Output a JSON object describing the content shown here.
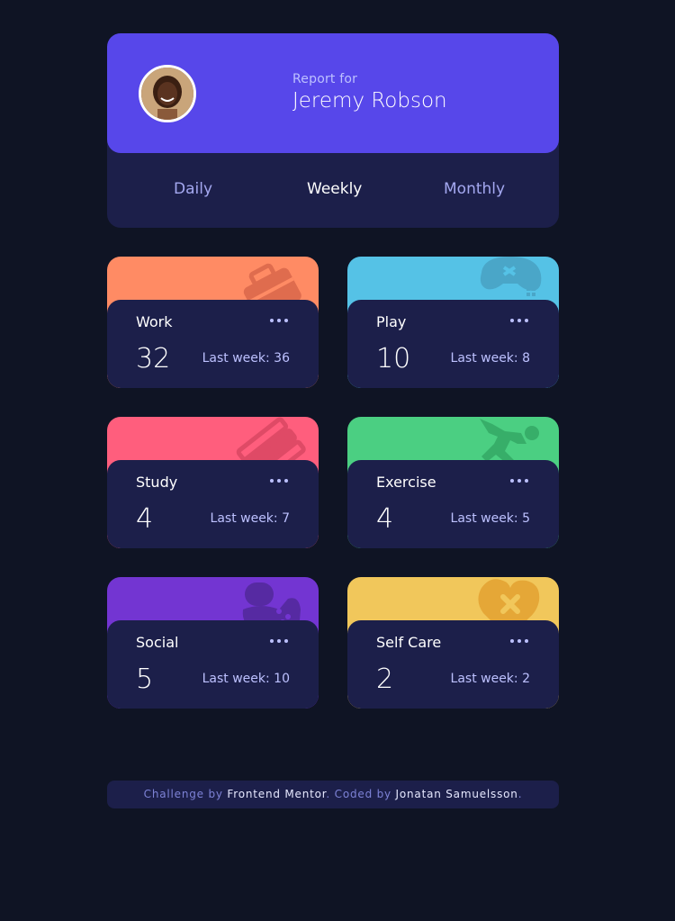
{
  "profile": {
    "report_for": "Report for",
    "name": "Jeremy Robson",
    "avatar_icon": "avatar-photo"
  },
  "tabs": [
    {
      "label": "Daily",
      "active": false
    },
    {
      "label": "Weekly",
      "active": true
    },
    {
      "label": "Monthly",
      "active": false
    }
  ],
  "activities": [
    {
      "title": "Work",
      "current": "32",
      "previous": "Last week: 36",
      "color": "#ff8b64",
      "icon": "briefcase-icon",
      "icon_color": "#df6c4e"
    },
    {
      "title": "Play",
      "current": "10",
      "previous": "Last week: 8",
      "color": "#55c2e6",
      "icon": "gamepad-icon",
      "icon_color": "#4aa6c8"
    },
    {
      "title": "Study",
      "current": "4",
      "previous": "Last week: 7",
      "color": "#ff5e7d",
      "icon": "books-icon",
      "icon_color": "#df4a66"
    },
    {
      "title": "Exercise",
      "current": "4",
      "previous": "Last week: 5",
      "color": "#4bcf82",
      "icon": "running-person-icon",
      "icon_color": "#37ae69"
    },
    {
      "title": "Social",
      "current": "5",
      "previous": "Last week: 10",
      "color": "#7335d2",
      "icon": "chat-bubbles-icon",
      "icon_color": "#562aa2"
    },
    {
      "title": "Self Care",
      "current": "2",
      "previous": "Last week: 2",
      "color": "#f1c75b",
      "icon": "heart-bandage-icon",
      "icon_color": "#e5a737"
    }
  ],
  "footer": {
    "prefix": "Challenge by ",
    "link1": "Frontend Mentor",
    "middle": ". Coded by ",
    "link2": "Jonatan Samuelsson",
    "suffix": "."
  }
}
